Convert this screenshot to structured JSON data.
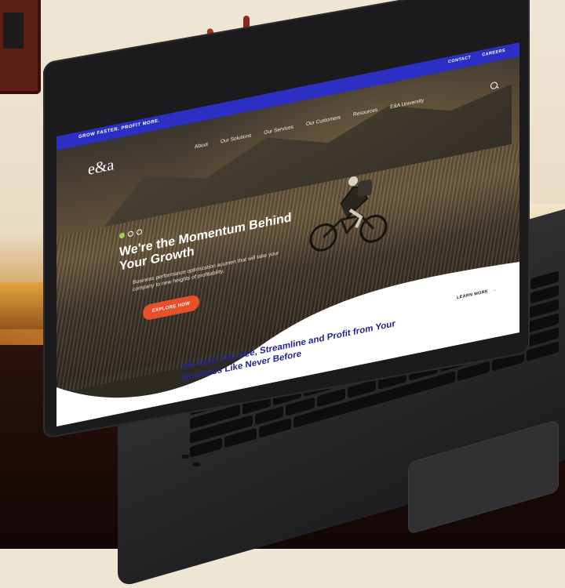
{
  "site": {
    "tagline": "GROW FASTER. PROFIT MORE.",
    "utility_links": [
      "CONTACT",
      "CAREERS"
    ],
    "logo": "e&a",
    "nav": [
      "About",
      "Our Solutions",
      "Our Services",
      "Our Customers",
      "Resources",
      "E&A University"
    ],
    "hero": {
      "heading": "We're the Momentum Behind Your Growth",
      "subtext": "Business performance optimization acumen that will take your company to new heights of profitability.",
      "cta": "EXPLORE HOW"
    },
    "learn_more": "LEARN MORE",
    "section_heading": "We Help You See, Streamline and Profit from Your Business Like Never Before"
  },
  "colors": {
    "topbar": "#2b2fc4",
    "cta": "#e8502a",
    "heading_blue": "#23248f",
    "slider_active": "#9bd24b"
  },
  "icons": [
    "search-icon",
    "arrow-right-icon"
  ]
}
